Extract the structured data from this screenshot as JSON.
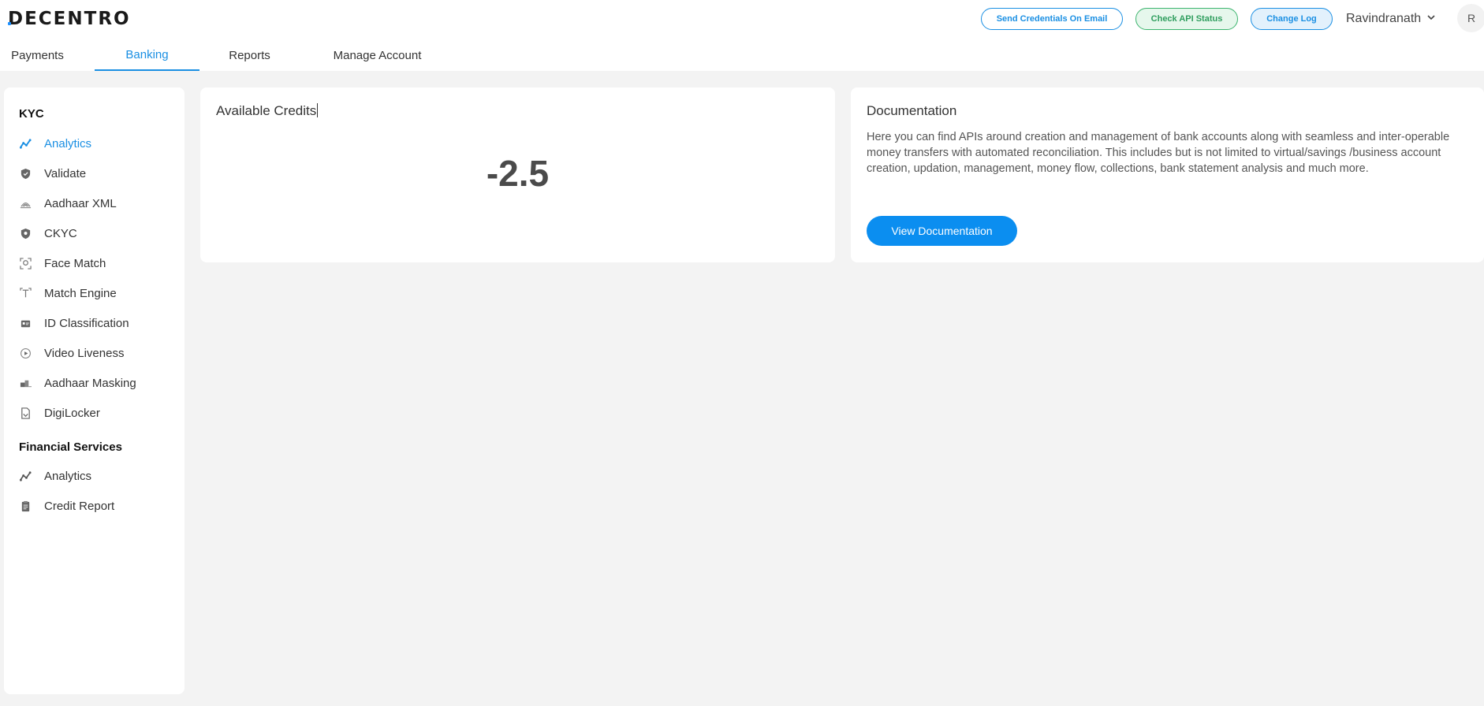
{
  "brand": {
    "logo_text": "DECENTRO"
  },
  "header": {
    "buttons": [
      {
        "label": "Send Credentials On Email"
      },
      {
        "label": "Check API Status"
      },
      {
        "label": "Change Log"
      }
    ],
    "user_name": "Ravindranath",
    "avatar_initial": "R"
  },
  "tabs": [
    {
      "label": "Payments"
    },
    {
      "label": "Banking",
      "active": true
    },
    {
      "label": "Reports"
    },
    {
      "label": "Manage Account"
    }
  ],
  "sidebar": {
    "sections": [
      {
        "title": "KYC",
        "items": [
          {
            "label": "Analytics",
            "icon": "analytics-icon",
            "active": true
          },
          {
            "label": "Validate",
            "icon": "shield-icon"
          },
          {
            "label": "Aadhaar XML",
            "icon": "aadhaar-icon"
          },
          {
            "label": "CKYC",
            "icon": "shield-icon"
          },
          {
            "label": "Face Match",
            "icon": "face-scan-icon"
          },
          {
            "label": "Match Engine",
            "icon": "text-match-icon"
          },
          {
            "label": "ID Classification",
            "icon": "id-card-icon"
          },
          {
            "label": "Video Liveness",
            "icon": "video-play-icon"
          },
          {
            "label": "Aadhaar Masking",
            "icon": "masking-icon"
          },
          {
            "label": "DigiLocker",
            "icon": "document-icon"
          }
        ]
      },
      {
        "title": "Financial Services",
        "items": [
          {
            "label": "Analytics",
            "icon": "analytics-icon"
          },
          {
            "label": "Credit Report",
            "icon": "report-icon"
          }
        ]
      }
    ]
  },
  "credits": {
    "title": "Available Credits",
    "value": "-2.5"
  },
  "documentation": {
    "title": "Documentation",
    "body": "Here you can find APIs around creation and management of bank accounts along with seamless and inter-operable money transfers with automated reconciliation. This includes but is not limited to virtual/savings /business account creation, updation, management, money flow, collections, bank statement analysis and much more.",
    "button_label": "View Documentation"
  },
  "colors": {
    "accent": "#1a8fe3",
    "success": "#3cb46e",
    "background": "#f3f3f3"
  }
}
